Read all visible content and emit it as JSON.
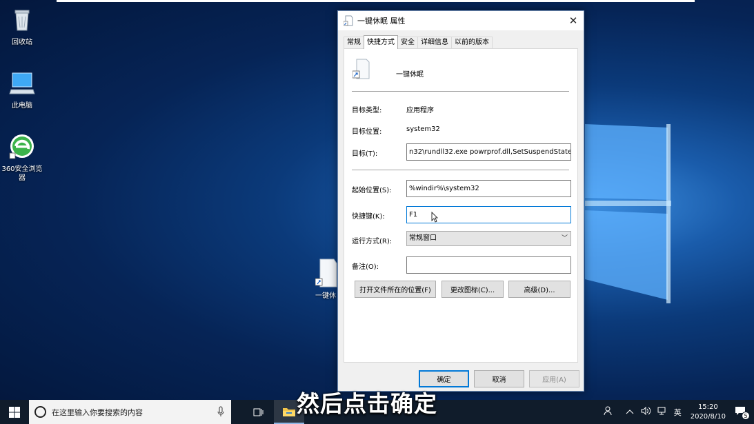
{
  "desktop": {
    "icons": [
      {
        "label": "回收站",
        "icon": "recycle-bin-icon"
      },
      {
        "label": "此电脑",
        "icon": "computer-icon"
      },
      {
        "label": "360安全浏览器",
        "icon": "360-browser-icon"
      }
    ],
    "hidden_icon_label": "一键休"
  },
  "dialog": {
    "title": "一键休眠 属性",
    "close_glyph": "✕",
    "tabs": [
      {
        "label": "常规",
        "active": false
      },
      {
        "label": "快捷方式",
        "active": true
      },
      {
        "label": "安全",
        "active": false
      },
      {
        "label": "详细信息",
        "active": false
      },
      {
        "label": "以前的版本",
        "active": false
      }
    ],
    "shortcut_name": "一键休眠",
    "target_type_label": "目标类型:",
    "target_type_value": "应用程序",
    "target_location_label": "目标位置:",
    "target_location_value": "system32",
    "target_label": "目标(T):",
    "target_value": "n32\\rundll32.exe powrprof.dll,SetSuspendState",
    "start_in_label": "起始位置(S):",
    "start_in_value": "%windir%\\system32",
    "hotkey_label": "快捷键(K):",
    "hotkey_value": "F1",
    "run_label": "运行方式(R):",
    "run_value": "常规窗口",
    "comment_label": "备注(O):",
    "comment_value": "",
    "open_location_button": "打开文件所在的位置(F)",
    "change_icon_button": "更改图标(C)...",
    "advanced_button": "高级(D)...",
    "ok_button": "确定",
    "cancel_button": "取消",
    "apply_button": "应用(A)"
  },
  "caption": "然后点击确定",
  "taskbar": {
    "search_placeholder": "在这里输入你要搜索的内容",
    "time": "15:20",
    "date": "2020/8/10",
    "ime": "英",
    "notification_count": "5"
  },
  "colors": {
    "accent": "#0078d7",
    "taskbar": "#101c2b"
  }
}
